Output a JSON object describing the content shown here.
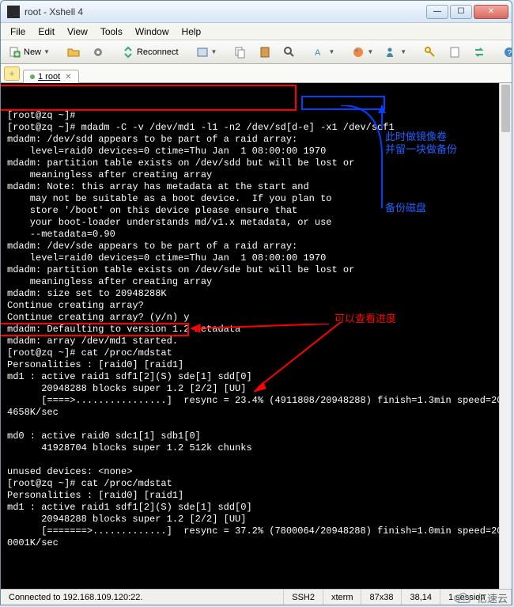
{
  "window": {
    "title": "root - Xshell 4"
  },
  "menubar": {
    "items": [
      "File",
      "Edit",
      "View",
      "Tools",
      "Window",
      "Help"
    ]
  },
  "toolbar": {
    "new_label": "New",
    "reconnect_label": "Reconnect"
  },
  "tabs": {
    "active": "1 root"
  },
  "terminal": {
    "lines": [
      "[root@zq ~]#",
      "[root@zq ~]# mdadm -C -v /dev/md1 -l1 -n2 /dev/sd[d-e] -x1 /dev/sdf1",
      "mdadm: /dev/sdd appears to be part of a raid array:",
      "    level=raid0 devices=0 ctime=Thu Jan  1 08:00:00 1970",
      "mdadm: partition table exists on /dev/sdd but will be lost or",
      "    meaningless after creating array",
      "mdadm: Note: this array has metadata at the start and",
      "    may not be suitable as a boot device.  If you plan to",
      "    store '/boot' on this device please ensure that",
      "    your boot-loader understands md/v1.x metadata, or use",
      "    --metadata=0.90",
      "mdadm: /dev/sde appears to be part of a raid array:",
      "    level=raid0 devices=0 ctime=Thu Jan  1 08:00:00 1970",
      "mdadm: partition table exists on /dev/sde but will be lost or",
      "    meaningless after creating array",
      "mdadm: size set to 20948288K",
      "Continue creating array?",
      "Continue creating array? (y/n) y",
      "mdadm: Defaulting to version 1.2 metadata",
      "mdadm: array /dev/md1 started.",
      "[root@zq ~]# cat /proc/mdstat",
      "Personalities : [raid0] [raid1]",
      "md1 : active raid1 sdf1[2](S) sde[1] sdd[0]",
      "      20948288 blocks super 1.2 [2/2] [UU]",
      "      [====>................]  resync = 23.4% (4911808/20948288) finish=1.3min speed=20",
      "4658K/sec",
      "",
      "md0 : active raid0 sdc1[1] sdb1[0]",
      "      41928704 blocks super 1.2 512k chunks",
      "",
      "unused devices: <none>",
      "[root@zq ~]# cat /proc/mdstat",
      "Personalities : [raid0] [raid1]",
      "md1 : active raid1 sdf1[2](S) sde[1] sdd[0]",
      "      20948288 blocks super 1.2 [2/2] [UU]",
      "      [=======>.............]  resync = 37.2% (7800064/20948288) finish=1.0min speed=20",
      "0001K/sec",
      ""
    ]
  },
  "annotations": {
    "blue1": "此时做镜像卷",
    "blue2": "并留一块做备份",
    "blue3": "备份磁盘",
    "red1": "可以查看进度"
  },
  "statusbar": {
    "connection": "Connected to 192.168.109.120:22.",
    "protocol": "SSH2",
    "term": "xterm",
    "size": "87x38",
    "cursor": "38,14",
    "sessions": "1 session"
  },
  "watermark": {
    "text": "亿速云"
  }
}
